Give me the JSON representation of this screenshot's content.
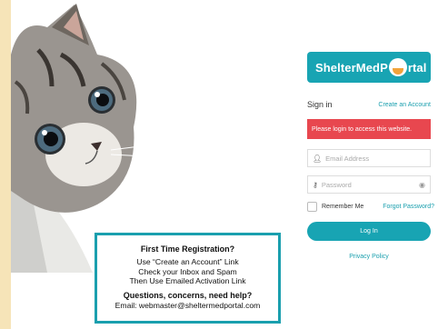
{
  "registration": {
    "heading": "First Time Registration?",
    "line1": "Use “Create an Account” Link",
    "line2": "Check your Inbox and Spam",
    "line3": "Then Use Emailed Activation Link",
    "question": "Questions, concerns, need help?",
    "email": "Email:  webmaster@sheltermedportal.com"
  },
  "logo": {
    "text_before": "ShelterMedP",
    "text_after": "rtal"
  },
  "login": {
    "title": "Sign in",
    "create_account": "Create an Account",
    "alert": "Please login to access this website.",
    "email_placeholder": "Email Address",
    "password_placeholder": "Password",
    "remember_me": "Remember Me",
    "forgot_password": "Forgot Password?",
    "login_button": "Log In",
    "privacy_policy": "Privacy Policy"
  },
  "icons": {
    "user": "user-icon",
    "key": "key-icon",
    "eye": "eye-icon"
  },
  "colors": {
    "accent": "#18a4b3",
    "alert": "#e8474f",
    "background": "#f6e4b8"
  }
}
